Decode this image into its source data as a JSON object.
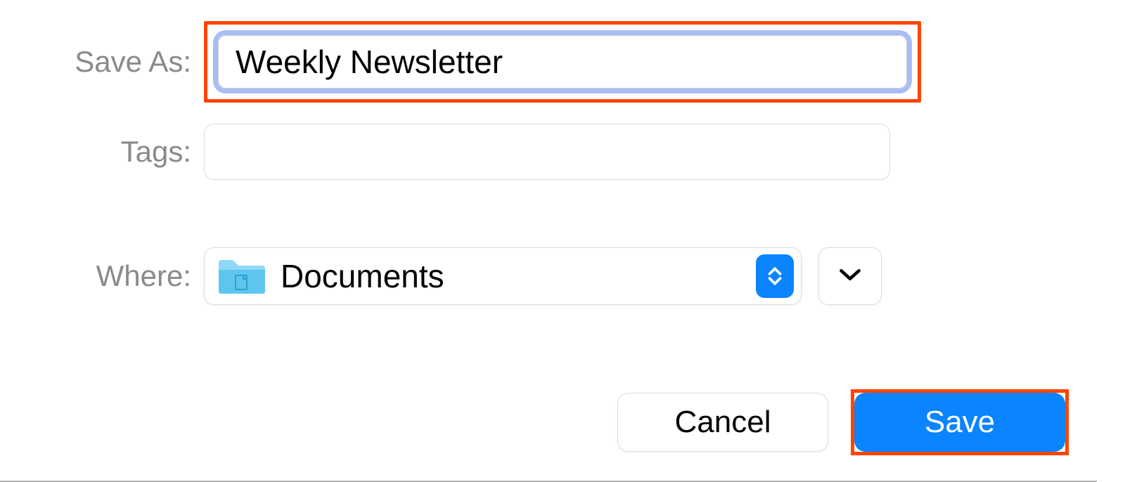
{
  "labels": {
    "save_as": "Save As:",
    "tags": "Tags:",
    "where": "Where:"
  },
  "fields": {
    "save_as_value": "Weekly Newsletter",
    "tags_value": "",
    "where_value": "Documents"
  },
  "buttons": {
    "cancel": "Cancel",
    "save": "Save"
  },
  "colors": {
    "accent": "#0a84ff",
    "highlight": "#ff4500",
    "focus_ring": "#a9bdf5",
    "label_gray": "#8a8a8a",
    "folder_light": "#8ed8f8",
    "folder_dark": "#5ec5ef"
  }
}
